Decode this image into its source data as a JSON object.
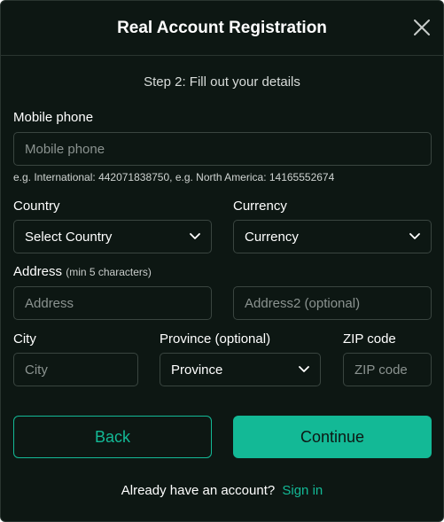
{
  "title": "Real Account Registration",
  "step": "Step 2: Fill out your details",
  "mobile": {
    "label": "Mobile phone",
    "placeholder": "Mobile phone",
    "hint": "e.g. International: 442071838750, e.g. North America: 14165552674"
  },
  "country": {
    "label": "Country",
    "selected": "Select Country"
  },
  "currency": {
    "label": "Currency",
    "selected": "Currency"
  },
  "address": {
    "label": "Address",
    "note": "(min 5 characters)",
    "placeholder": "Address",
    "placeholder2": "Address2 (optional)"
  },
  "city": {
    "label": "City",
    "placeholder": "City"
  },
  "province": {
    "label": "Province (optional)",
    "selected": "Province"
  },
  "zip": {
    "label": "ZIP code",
    "placeholder": "ZIP code"
  },
  "buttons": {
    "back": "Back",
    "continue": "Continue"
  },
  "footer": {
    "text": "Already have an account?",
    "link": "Sign in"
  },
  "colors": {
    "accent": "#13b996",
    "background": "#0d1713",
    "border": "#3a4540"
  },
  "icons": {
    "close": "close-icon",
    "dropdown": "chevron-down-icon"
  }
}
